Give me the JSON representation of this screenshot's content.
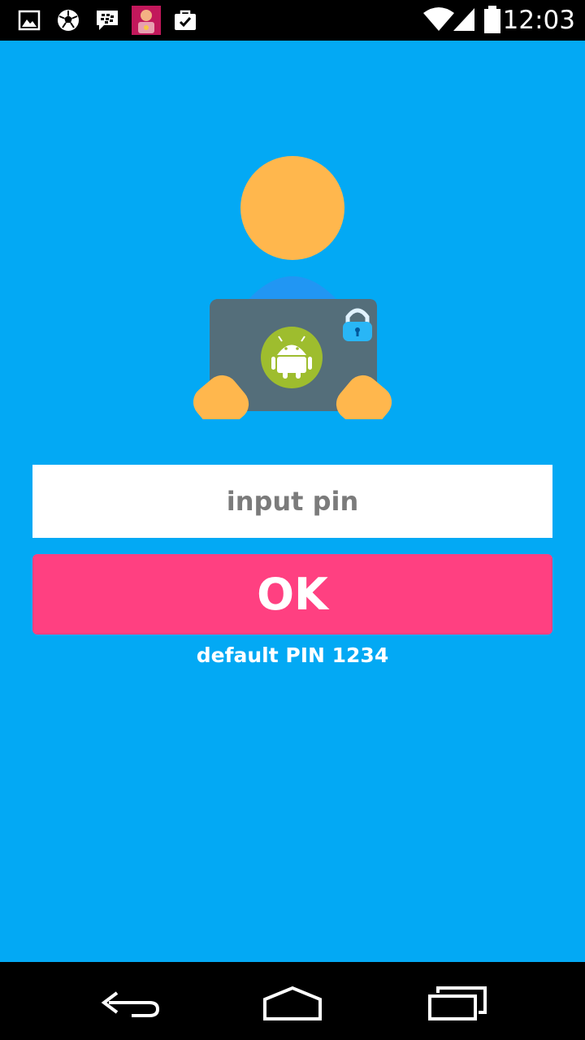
{
  "status_bar": {
    "notification_icons": [
      "gallery-icon",
      "soccer-ball-icon",
      "blackberry-messenger-icon",
      "app-thumbnail-icon",
      "briefcase-check-icon"
    ],
    "system_icons": [
      "wifi-icon",
      "signal-icon",
      "battery-icon"
    ],
    "time": "12:03"
  },
  "login": {
    "illustration_icons": [
      "user-avatar-icon",
      "laptop-icon",
      "android-icon",
      "lock-icon"
    ],
    "pin_placeholder": "input pin",
    "pin_value": "",
    "ok_label": "OK",
    "hint": "default PIN 1234"
  },
  "nav_bar": {
    "buttons": [
      "back-icon",
      "home-icon",
      "recents-icon"
    ]
  },
  "colors": {
    "background": "#03a9f4",
    "accent_button": "#ff4081",
    "avatar_skin": "#ffb74d",
    "laptop": "#546e7a",
    "android_badge": "#9ebd2e"
  }
}
